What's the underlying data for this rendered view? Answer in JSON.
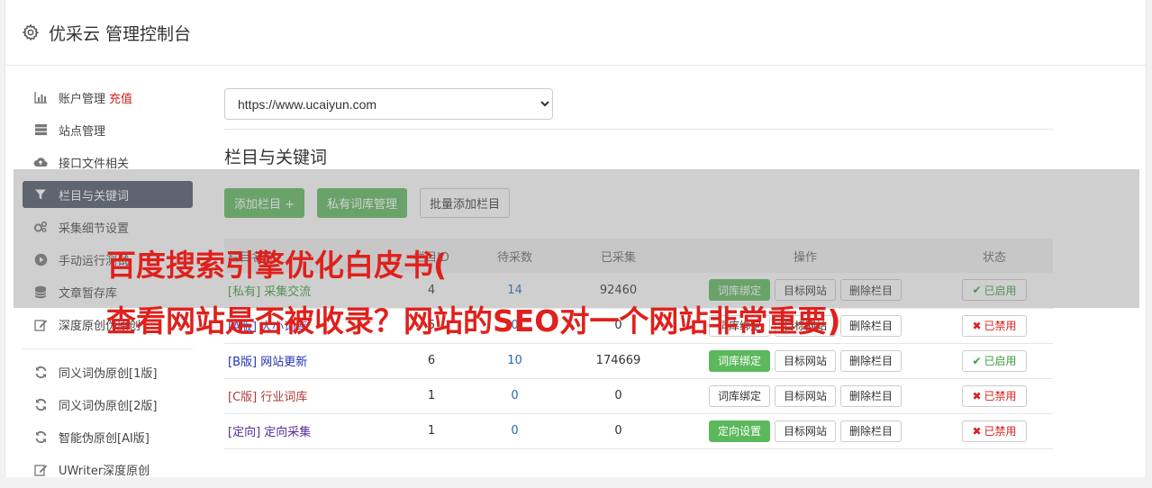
{
  "header": {
    "title": "优采云 管理控制台"
  },
  "sidebar": {
    "items": [
      {
        "label": "账户管理",
        "extra": "充值",
        "icon": "bar-chart-icon"
      },
      {
        "label": "站点管理",
        "icon": "server-icon"
      },
      {
        "label": "接口文件相关",
        "icon": "cloud-upload-icon"
      },
      {
        "label": "栏目与关键词",
        "icon": "filter-icon",
        "active": true
      },
      {
        "label": "采集细节设置",
        "icon": "cogs-icon"
      },
      {
        "label": "手动运行测试",
        "icon": "play-circle-icon"
      },
      {
        "label": "文章暂存库",
        "icon": "database-icon"
      },
      {
        "label": "深度原创伪原创",
        "icon": "edit-icon"
      }
    ],
    "items2": [
      {
        "label": "同义词伪原创[1版]",
        "icon": "refresh-icon"
      },
      {
        "label": "同义词伪原创[2版]",
        "icon": "refresh-icon"
      },
      {
        "label": "智能伪原创[AI版]",
        "icon": "refresh-icon"
      },
      {
        "label": "UWriter深度原创",
        "icon": "edit-icon"
      }
    ]
  },
  "main": {
    "site_select": "https://www.ucaiyun.com",
    "section_title": "栏目与关键词",
    "buttons": {
      "add_column": "添加栏目 +",
      "private_lib": "私有词库管理",
      "batch_add": "批量添加栏目"
    }
  },
  "table": {
    "headers": [
      "栏目名称",
      "栏目ID",
      "待采数",
      "已采集",
      "操作",
      "状态"
    ],
    "rows": [
      {
        "name": "[私有] 采集交流",
        "id": "4",
        "pending": "14",
        "collected": "92460",
        "op1": "词库绑定",
        "op2": "目标网站",
        "op3": "删除栏目",
        "status": "已启用",
        "state": "on",
        "cls": "c-private",
        "op1green": true
      },
      {
        "name": "[A版] 大小词库",
        "id": "5",
        "pending": "0",
        "collected": "0",
        "op1": "词库绑定",
        "op2": "目标网站",
        "op3": "删除栏目",
        "status": "已禁用",
        "state": "off",
        "cls": "c-a",
        "op1green": false
      },
      {
        "name": "[B版] 网站更新",
        "id": "6",
        "pending": "10",
        "collected": "174669",
        "op1": "词库绑定",
        "op2": "目标网站",
        "op3": "删除栏目",
        "status": "已启用",
        "state": "on",
        "cls": "c-b",
        "op1green": true
      },
      {
        "name": "[C版] 行业词库",
        "id": "1",
        "pending": "0",
        "collected": "0",
        "op1": "词库绑定",
        "op2": "目标网站",
        "op3": "删除栏目",
        "status": "已禁用",
        "state": "off",
        "cls": "c-c",
        "op1green": false
      },
      {
        "name": "[定向] 定向采集",
        "id": "1",
        "pending": "0",
        "collected": "0",
        "op1": "定向设置",
        "op2": "目标网站",
        "op3": "删除栏目",
        "status": "已禁用",
        "state": "off",
        "cls": "c-dir",
        "op1green": true
      }
    ]
  },
  "overlay": {
    "line1": "百度搜索引擎优化白皮书(",
    "line2": "查看网站是否被收录？网站的SEO对一个网站非常重要)"
  },
  "colors": {
    "active_sidebar": "#4a5466",
    "green": "#5cb85c",
    "red": "#e0201c"
  }
}
